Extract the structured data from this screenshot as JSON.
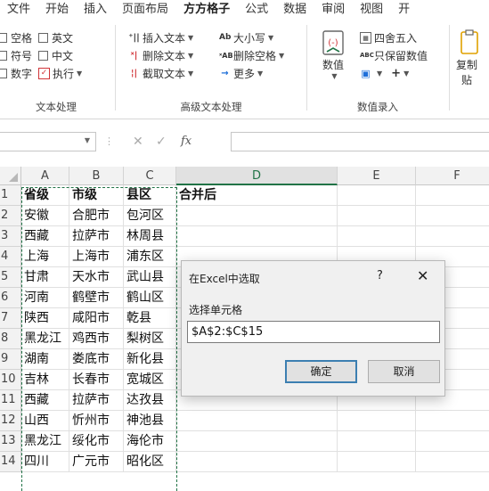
{
  "menu": {
    "tabs": [
      "文件",
      "开始",
      "插入",
      "页面布局",
      "方方格子",
      "公式",
      "数据",
      "审阅",
      "视图",
      "开"
    ],
    "active_index": 4
  },
  "ribbon": {
    "text_group": {
      "label": "文本处理",
      "checkboxes": [
        [
          "空格",
          "英文"
        ],
        [
          "符号",
          "中文"
        ],
        [
          "数字"
        ]
      ],
      "execute_label": "执行"
    },
    "advanced_group": {
      "label": "高级文本处理",
      "col1": [
        "插入文本",
        "删除文本",
        "截取文本"
      ],
      "col2": [
        "大小写",
        "删除空格",
        "更多"
      ]
    },
    "number_group": {
      "label": "数值录入",
      "big_button": "数值",
      "items": [
        "四舍五入",
        "只保留数值"
      ]
    },
    "clipboard_group": {
      "label_line1": "复制",
      "label_line2": "贴"
    }
  },
  "formula_bar": {
    "fx_label": "fx",
    "name_value": "",
    "formula_value": ""
  },
  "sheet": {
    "columns": [
      "A",
      "B",
      "C",
      "D",
      "E",
      "F"
    ],
    "selected_column": "D",
    "rows": [
      [
        "省级",
        "市级",
        "县区",
        "合并后"
      ],
      [
        "安徽",
        "合肥市",
        "包河区",
        ""
      ],
      [
        "西藏",
        "拉萨市",
        "林周县",
        ""
      ],
      [
        "上海",
        "上海市",
        "浦东区",
        ""
      ],
      [
        "甘肃",
        "天水市",
        "武山县",
        ""
      ],
      [
        "河南",
        "鹤壁市",
        "鹤山区",
        ""
      ],
      [
        "陕西",
        "咸阳市",
        "乾县",
        ""
      ],
      [
        "黑龙江",
        "鸡西市",
        "梨树区",
        ""
      ],
      [
        "湖南",
        "娄底市",
        "新化县",
        ""
      ],
      [
        "吉林",
        "长春市",
        "宽城区",
        ""
      ],
      [
        "西藏",
        "拉萨市",
        "达孜县",
        ""
      ],
      [
        "山西",
        "忻州市",
        "神池县",
        ""
      ],
      [
        "黑龙江",
        "绥化市",
        "海伦市",
        ""
      ],
      [
        "四川",
        "广元市",
        "昭化区",
        ""
      ]
    ]
  },
  "dialog": {
    "title": "在Excel中选取",
    "help": "?",
    "close": "✕",
    "prompt": "选择单元格",
    "input_value": "$A$2:$C$15",
    "ok_label": "确定",
    "cancel_label": "取消"
  },
  "colors": {
    "accent": "#217346",
    "dialog_bg": "#f0f0f0",
    "primary_button_border": "#3c7fb1"
  }
}
